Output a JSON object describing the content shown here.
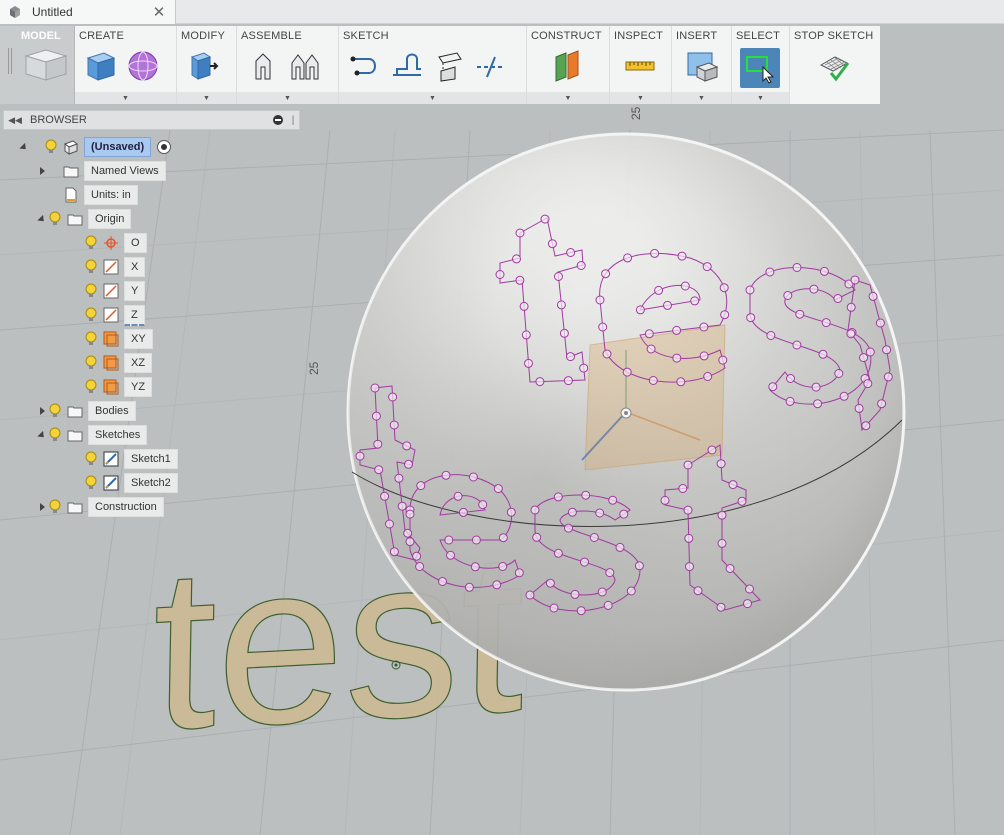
{
  "document": {
    "tab_title": "Untitled",
    "close_glyph": "✕"
  },
  "workspace": {
    "label": "MODEL"
  },
  "toolbar": {
    "groups": [
      {
        "title": "CREATE",
        "tools": [
          "box-icon",
          "sphere-icon"
        ]
      },
      {
        "title": "MODIFY",
        "tools": [
          "press-pull-icon"
        ]
      },
      {
        "title": "ASSEMBLE",
        "tools": [
          "new-component-icon",
          "joint-icon"
        ]
      },
      {
        "title": "SKETCH",
        "tools": [
          "sketch-line-icon",
          "sketch-trim-icon",
          "sketch-project-icon",
          "sketch-construction-icon"
        ]
      },
      {
        "title": "CONSTRUCT",
        "tools": [
          "offset-plane-icon"
        ]
      },
      {
        "title": "INSPECT",
        "tools": [
          "measure-icon"
        ]
      },
      {
        "title": "INSERT",
        "tools": [
          "insert-image-icon"
        ]
      },
      {
        "title": "SELECT",
        "tools": [
          "select-icon"
        ]
      },
      {
        "title": "STOP SKETCH",
        "tools": [
          "stop-sketch-icon"
        ]
      }
    ]
  },
  "browser": {
    "title": "BROWSER",
    "root": {
      "label": "(Unsaved)"
    },
    "items": [
      {
        "label": "Named Views"
      },
      {
        "label": "Units: in"
      },
      {
        "label": "Origin"
      },
      {
        "label": "O"
      },
      {
        "label": "X"
      },
      {
        "label": "Y"
      },
      {
        "label": "Z"
      },
      {
        "label": "XY"
      },
      {
        "label": "XZ"
      },
      {
        "label": "YZ"
      },
      {
        "label": "Bodies"
      },
      {
        "label": "Sketches"
      },
      {
        "label": "Sketch1"
      },
      {
        "label": "Sketch2"
      },
      {
        "label": "Construction"
      }
    ]
  },
  "viewport": {
    "grid_label_top": "25",
    "grid_label_left": "25",
    "text_label": "test",
    "colors": {
      "background": "#b9bcbd",
      "sketch_profile": "#a03aa0",
      "text_fill": "#cbb994",
      "sphere": "#e6e6e6"
    }
  }
}
